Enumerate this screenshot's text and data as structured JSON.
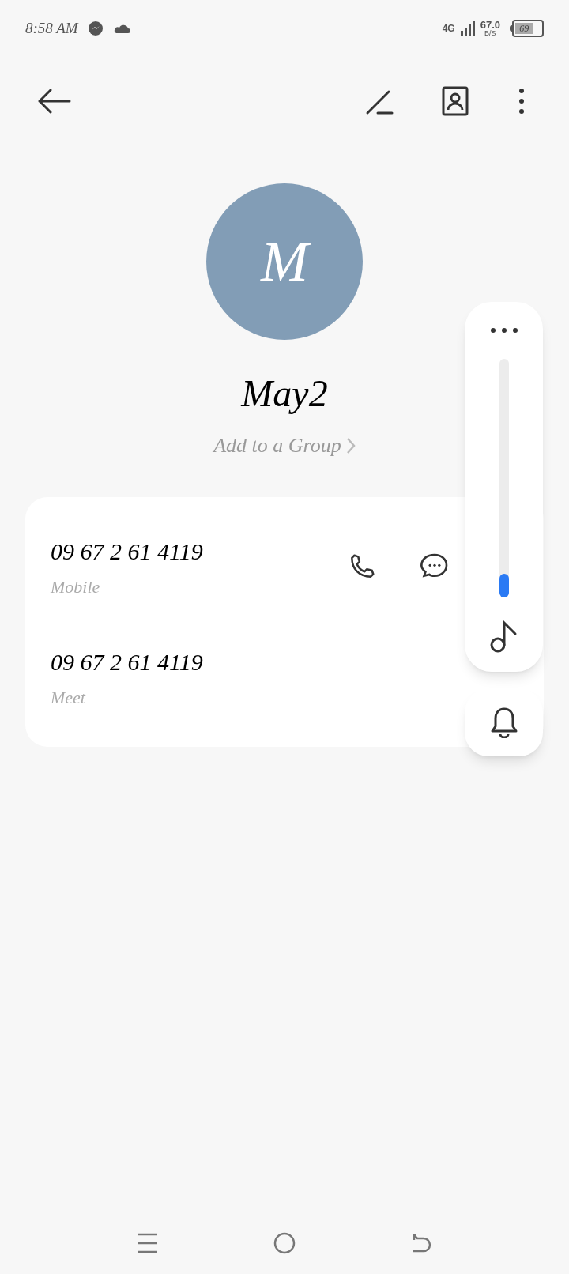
{
  "status_bar": {
    "time": "8:58 AM",
    "network": "4G",
    "speed": "67.0",
    "speed_unit": "B/S",
    "battery": "69"
  },
  "contact": {
    "initial": "M",
    "name": "May2",
    "group_link": "Add to a Group"
  },
  "numbers": [
    {
      "number": "09 67 2 61 4119",
      "label": "Mobile",
      "actions": true
    },
    {
      "number": "09 67 2 61 4119",
      "label": "Meet",
      "actions": false
    }
  ],
  "volume_panel": {
    "level": 0.1
  }
}
